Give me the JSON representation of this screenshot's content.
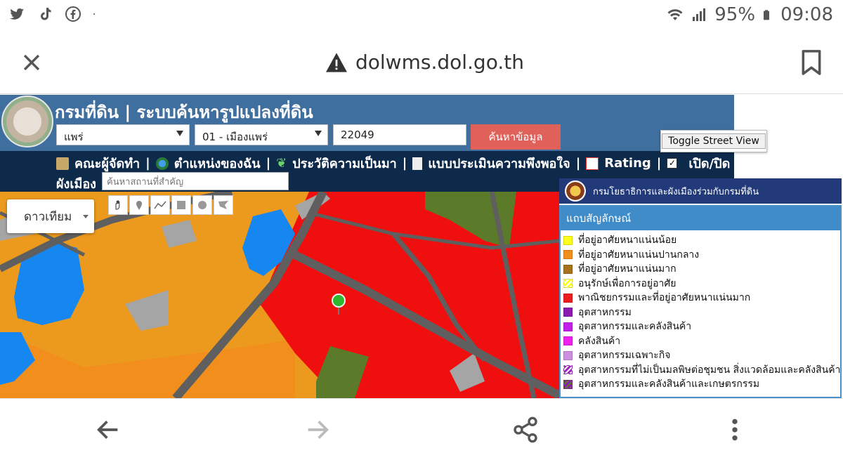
{
  "status_bar": {
    "battery": "95%",
    "time": "09:08",
    "icons": [
      "twitter-icon",
      "tiktok-icon",
      "facebook-icon",
      "dot-icon",
      "wifi-icon",
      "signal-icon",
      "battery-icon"
    ]
  },
  "browser": {
    "url": "dolwms.dol.go.th",
    "close_icon": "close-icon",
    "warning_icon": "warning-icon",
    "bookmark_icon": "bookmark-icon"
  },
  "header": {
    "title": "กรมที่ดิน | ระบบค้นหารูปแปลงที่ดิน",
    "province": "แพร่",
    "district": "01 - เมืองแพร่",
    "parcel_code": "22049",
    "search_label": "ค้นหาข้อมูล"
  },
  "nav": {
    "items": [
      "คณะผู้จัดทำ",
      "ตำแหน่งของฉัน",
      "ประวัติความเป็นมา",
      "แบบประเมินความพึงพอใจ",
      "Rating",
      "เปิด/ปิด -"
    ],
    "line2_label": "ผังเมือง",
    "place_placeholder": "ค้นหาสถานที่สำคัญ",
    "separator": "|"
  },
  "street_view": {
    "label": "Toggle Street View"
  },
  "map": {
    "type_label": "ดาวเทียม",
    "tools": [
      "hand-icon",
      "marker-icon",
      "polyline-icon",
      "rectangle-icon",
      "circle-icon",
      "polygon-icon"
    ],
    "colors": {
      "orange": "#ec9a1e",
      "red": "#f00f0f",
      "green": "#5b7a2a",
      "blue": "#1687f0",
      "gray": "#a5a5a5",
      "road": "#5f5f5f"
    }
  },
  "legend": {
    "agency": "กรมโยธาธิการและผังเมืองร่วมกับกรมที่ดิน",
    "title": "แถบสัญลักษณ์",
    "items": [
      {
        "label": "ที่อยู่อาศัยหนาแน่นน้อย",
        "color": "#ffff1a",
        "pattern": "solid"
      },
      {
        "label": "ที่อยู่อาศัยหนาแน่นปานกลาง",
        "color": "#f28e1c",
        "pattern": "solid"
      },
      {
        "label": "ที่อยู่อาศัยหนาแน่นมาก",
        "color": "#a6731c",
        "pattern": "solid"
      },
      {
        "label": "อนุรักษ์เพื่อการอยู่อาศัย",
        "color": "#ffff1a",
        "pattern": "hatch"
      },
      {
        "label": "พาณิชยกรรมและที่อยู่อาศัยหนาแน่นมาก",
        "color": "#ee1c1c",
        "pattern": "solid"
      },
      {
        "label": "อุตสาหกรรม",
        "color": "#8e1bb0",
        "pattern": "solid"
      },
      {
        "label": "อุตสาหกรรมและคลังสินค้า",
        "color": "#c220e8",
        "pattern": "solid"
      },
      {
        "label": "คลังสินค้า",
        "color": "#ee22ee",
        "pattern": "solid"
      },
      {
        "label": "อุตสาหกรรมเฉพาะกิจ",
        "color": "#cf8fe0",
        "pattern": "solid"
      },
      {
        "label": "อุตสาหกรรมที่ไม่เป็นมลพิษต่อชุมชน สิ่งแวดล้อมและคลังสินค้า",
        "color": "#a020c0",
        "pattern": "hatch"
      },
      {
        "label": "อุตสาหกรรมและคลังสินค้าและเกษตรกรรม",
        "color": "#8e1bb0",
        "pattern": "hatch-green"
      }
    ]
  },
  "bottom_bar": {
    "icons": [
      "back-arrow-icon",
      "forward-arrow-icon",
      "share-icon",
      "more-vert-icon"
    ]
  }
}
